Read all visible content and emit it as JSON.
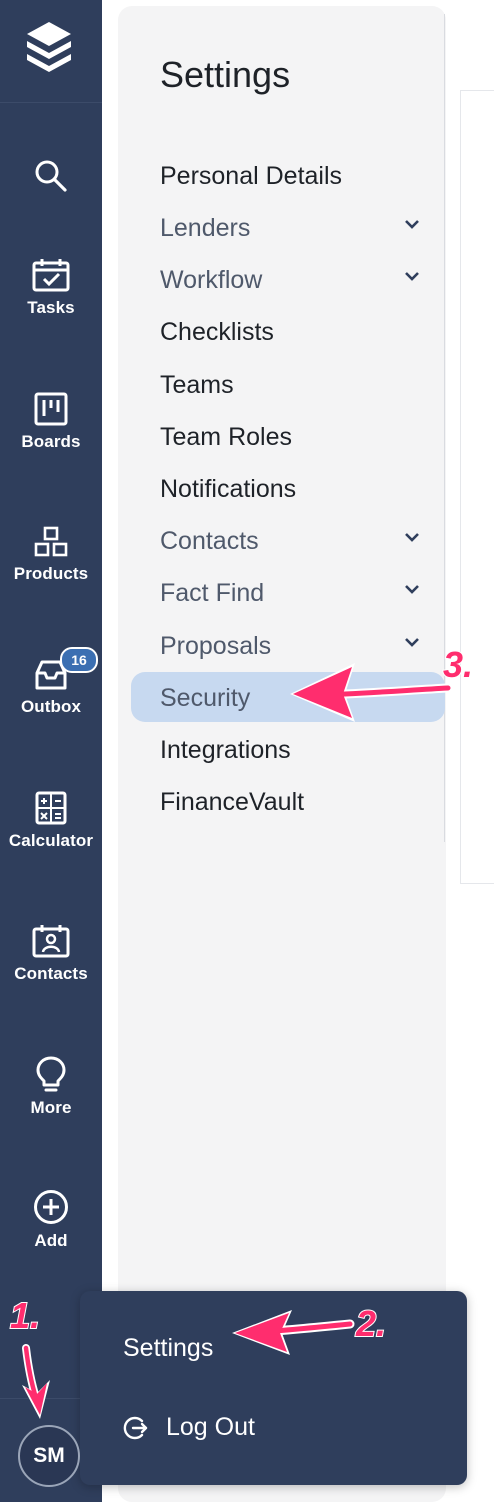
{
  "rail": {
    "logo_icon": "stack-layers-icon",
    "items": [
      {
        "label": "",
        "icon": "search-icon"
      },
      {
        "label": "Tasks",
        "icon": "calendar-check-icon"
      },
      {
        "label": "Boards",
        "icon": "kanban-board-icon"
      },
      {
        "label": "Products",
        "icon": "blocks-icon"
      },
      {
        "label": "Outbox",
        "icon": "inbox-tray-icon",
        "badge": "16"
      },
      {
        "label": "Calculator",
        "icon": "calculator-icon"
      },
      {
        "label": "Contacts",
        "icon": "contact-card-icon"
      },
      {
        "label": "More",
        "icon": "lightbulb-icon"
      },
      {
        "label": "Add",
        "icon": "plus-circle-icon"
      }
    ],
    "avatar_initials": "SM"
  },
  "settings": {
    "title": "Settings",
    "items": [
      {
        "label": "Personal Details",
        "expandable": false
      },
      {
        "label": "Lenders",
        "expandable": true
      },
      {
        "label": "Workflow",
        "expandable": true
      },
      {
        "label": "Checklists",
        "expandable": false
      },
      {
        "label": "Teams",
        "expandable": false
      },
      {
        "label": "Team Roles",
        "expandable": false
      },
      {
        "label": "Notifications",
        "expandable": false
      },
      {
        "label": "Contacts",
        "expandable": true
      },
      {
        "label": "Fact Find",
        "expandable": true
      },
      {
        "label": "Proposals",
        "expandable": true
      },
      {
        "label": "Security",
        "expandable": false,
        "active": true
      },
      {
        "label": "Integrations",
        "expandable": false
      },
      {
        "label": "FinanceVault",
        "expandable": false
      }
    ]
  },
  "user_menu": {
    "settings_label": "Settings",
    "logout_label": "Log Out"
  },
  "annotations": {
    "step1": "1.",
    "step2": "2.",
    "step3": "3."
  },
  "colors": {
    "rail_bg": "#2f3e5c",
    "panel_bg": "#f4f4f5",
    "active_bg": "#c7d9f0",
    "badge_bg": "#3b6fb2",
    "annotation": "#ff2d6e"
  }
}
